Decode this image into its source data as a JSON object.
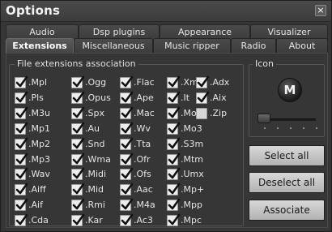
{
  "window": {
    "title": "Options",
    "close_symbol": "×"
  },
  "tabs_row1": [
    {
      "label": "Audio"
    },
    {
      "label": "Dsp plugins"
    },
    {
      "label": "Appearance"
    },
    {
      "label": "Visualizer"
    }
  ],
  "tabs_row2": [
    {
      "label": "Extensions",
      "active": true
    },
    {
      "label": "Miscellaneous"
    },
    {
      "label": "Music ripper"
    },
    {
      "label": "Radio"
    },
    {
      "label": "About"
    }
  ],
  "extensions_group": {
    "label": "File extensions association",
    "columns": [
      [
        {
          "label": ".Mpl",
          "checked": true
        },
        {
          "label": ".Pls",
          "checked": true
        },
        {
          "label": ".M3u",
          "checked": true
        },
        {
          "label": ".Mp1",
          "checked": true
        },
        {
          "label": ".Mp2",
          "checked": true
        },
        {
          "label": ".Mp3",
          "checked": true
        },
        {
          "label": ".Wav",
          "checked": true
        },
        {
          "label": ".Aiff",
          "checked": true
        },
        {
          "label": ".Aif",
          "checked": true
        },
        {
          "label": ".Cda",
          "checked": true
        }
      ],
      [
        {
          "label": ".Ogg",
          "checked": true
        },
        {
          "label": ".Opus",
          "checked": true
        },
        {
          "label": ".Spx",
          "checked": true
        },
        {
          "label": ".Au",
          "checked": true
        },
        {
          "label": ".Snd",
          "checked": true
        },
        {
          "label": ".Wma",
          "checked": true
        },
        {
          "label": ".Midi",
          "checked": true
        },
        {
          "label": ".Mid",
          "checked": true
        },
        {
          "label": ".Rmi",
          "checked": true
        },
        {
          "label": ".Kar",
          "checked": true
        }
      ],
      [
        {
          "label": ".Flac",
          "checked": true
        },
        {
          "label": ".Ape",
          "checked": true
        },
        {
          "label": ".Mac",
          "checked": true
        },
        {
          "label": ".Wv",
          "checked": true
        },
        {
          "label": ".Tta",
          "checked": true
        },
        {
          "label": ".Ofr",
          "checked": true
        },
        {
          "label": ".Ofs",
          "checked": true
        },
        {
          "label": ".Aac",
          "checked": true
        },
        {
          "label": ".M4a",
          "checked": true
        },
        {
          "label": ".Ac3",
          "checked": true
        }
      ],
      [
        {
          "label": ".Xm",
          "checked": true
        },
        {
          "label": ".It",
          "checked": true
        },
        {
          "label": ".Mod",
          "checked": true
        },
        {
          "label": ".Mo3",
          "checked": true
        },
        {
          "label": ".S3m",
          "checked": true
        },
        {
          "label": ".Mtm",
          "checked": true
        },
        {
          "label": ".Umx",
          "checked": true
        },
        {
          "label": ".Mp+",
          "checked": true
        },
        {
          "label": ".Mpp",
          "checked": true
        },
        {
          "label": ".Mpc",
          "checked": true
        }
      ],
      [
        {
          "label": ".Adx",
          "checked": true
        },
        {
          "label": ".Aix",
          "checked": true
        },
        {
          "label": ".Zip",
          "checked": false
        }
      ]
    ]
  },
  "icon_group": {
    "label": "Icon",
    "knob_letter": "M",
    "slider_position": 0
  },
  "buttons": {
    "select_all": "Select all",
    "deselect_all": "Deselect all",
    "associate": "Associate"
  }
}
